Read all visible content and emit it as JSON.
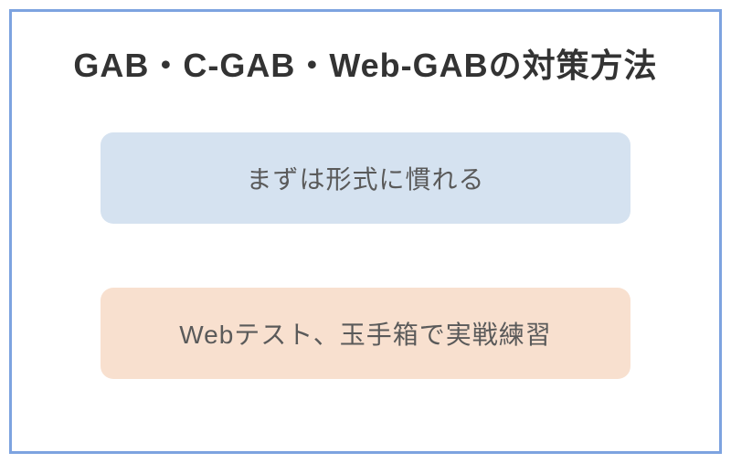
{
  "title": "GAB・C-GAB・Web-GABの対策方法",
  "cards": [
    {
      "label": "まずは形式に慣れる"
    },
    {
      "label": "Webテスト、玉手箱で実戦練習"
    }
  ]
}
